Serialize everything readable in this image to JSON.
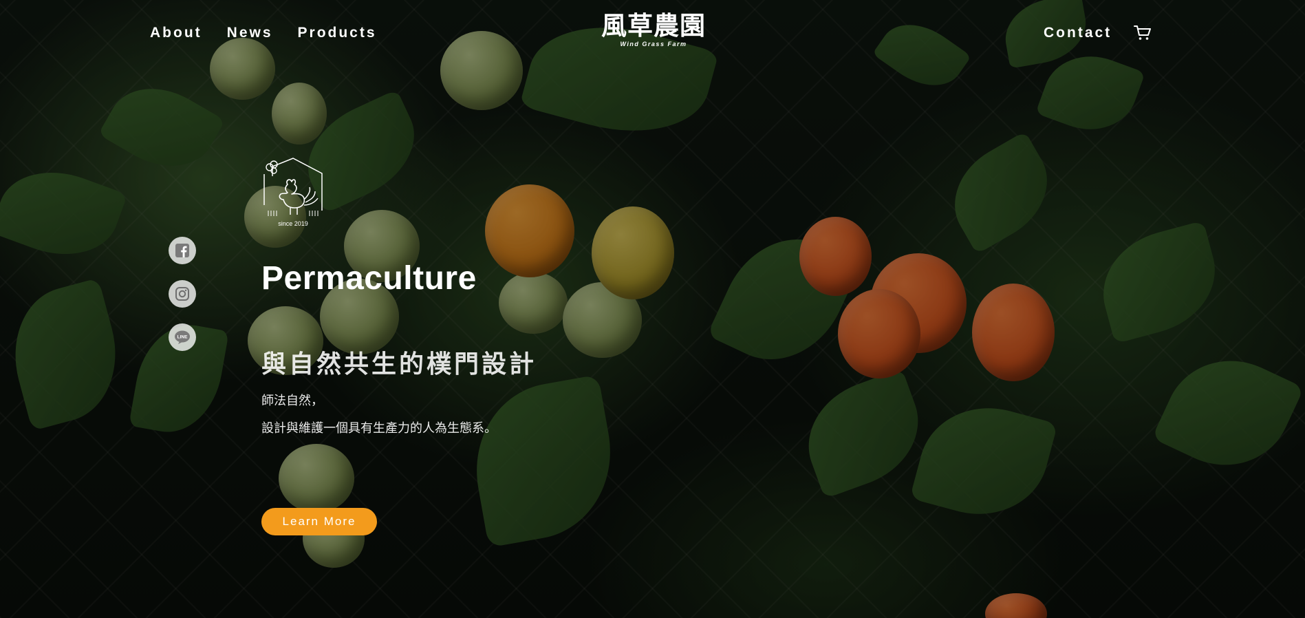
{
  "header": {
    "nav_left": [
      {
        "label": "About"
      },
      {
        "label": "News"
      },
      {
        "label": "Products"
      }
    ],
    "logo": {
      "cn": "風草農園",
      "en": "Wind Grass Farm"
    },
    "nav_right": {
      "contact_label": "Contact",
      "cart_icon": "cart-icon"
    }
  },
  "social": [
    {
      "name": "facebook",
      "icon": "facebook-icon"
    },
    {
      "name": "instagram",
      "icon": "instagram-icon"
    },
    {
      "name": "line",
      "icon": "line-icon",
      "label": "LINE"
    }
  ],
  "hero": {
    "badge_text": "since 2019",
    "title": "Permaculture",
    "subtitle": "與自然共生的樸門設計",
    "line1": "師法自然，",
    "line2": "設計與維護一個具有生產力的人為生態系。",
    "cta_label": "Learn More"
  },
  "colors": {
    "accent": "#f39b1c",
    "text": "#ffffff",
    "background": "#0c110c"
  }
}
